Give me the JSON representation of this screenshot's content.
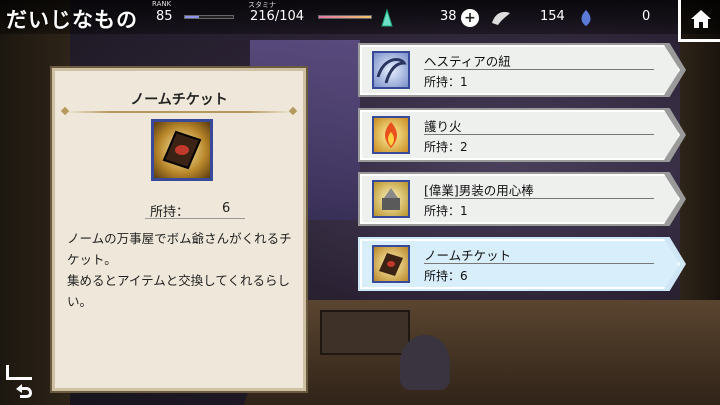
{
  "header": {
    "title": "だいじなもの",
    "rank_label": "RANK",
    "rank_value": "85",
    "stamina_label": "スタミナ",
    "stamina_value": "216/104",
    "currency_gem": "38",
    "currency_feather": "154",
    "currency_other": "0"
  },
  "detail": {
    "name": "ノームチケット",
    "owned_label": "所持：",
    "owned_value": "6",
    "description": "ノームの万事屋でボム爺さんがくれるチケット。\n集めるとアイテムと交換してくれるらしい。"
  },
  "items": [
    {
      "name": "ヘスティアの紐",
      "count": "所持：1"
    },
    {
      "name": "護り火",
      "count": "所持：2"
    },
    {
      "name": "[偉業]男装の用心棒",
      "count": "所持：1"
    },
    {
      "name": "ノームチケット",
      "count": "所持：6"
    }
  ],
  "colors": {
    "rank_bar": "#8f95e8",
    "stamina_bar": "#e77aa8",
    "selected_item_bg": "#d8eefa",
    "icon_frame": "#3a4a9a"
  },
  "icons": [
    "feather-gem-icon",
    "plus-icon",
    "wing-icon",
    "leaf-icon",
    "home-icon",
    "back-icon"
  ]
}
